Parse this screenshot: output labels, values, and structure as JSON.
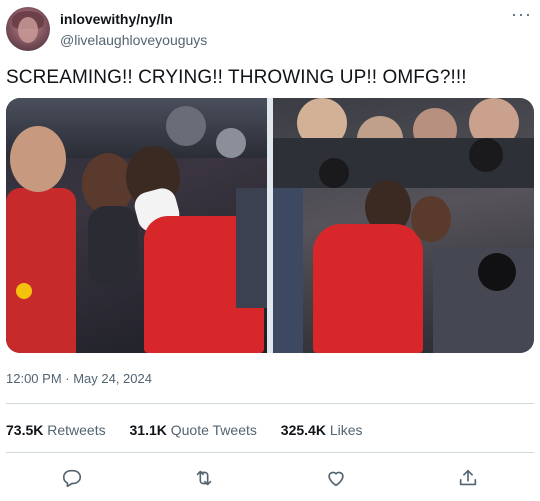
{
  "author": {
    "display_name": "inlovewithy/ny/ln",
    "handle": "@livelaughloveyouguys",
    "avatar": "profile-avatar"
  },
  "tweet": {
    "text": "SCREAMING!! CRYING!! THROWING UP!! OMFG?!!!",
    "timestamp": "12:00 PM · May 24, 2024"
  },
  "media": [
    {
      "icon": "photo-couple-kissing-crowd"
    },
    {
      "icon": "photo-driver-crowd-cameras"
    }
  ],
  "stats": {
    "retweets": {
      "count": "73.5K",
      "label": "Retweets"
    },
    "quotes": {
      "count": "31.1K",
      "label": "Quote Tweets"
    },
    "likes": {
      "count": "325.4K",
      "label": "Likes"
    }
  },
  "more_label": "···",
  "actions": [
    "reply-icon",
    "retweet-icon",
    "like-icon",
    "share-icon"
  ],
  "colors": {
    "text": "#0f1419",
    "secondary": "#536471",
    "divider": "#cfd9de",
    "ferrari_red": "#d8272b"
  }
}
